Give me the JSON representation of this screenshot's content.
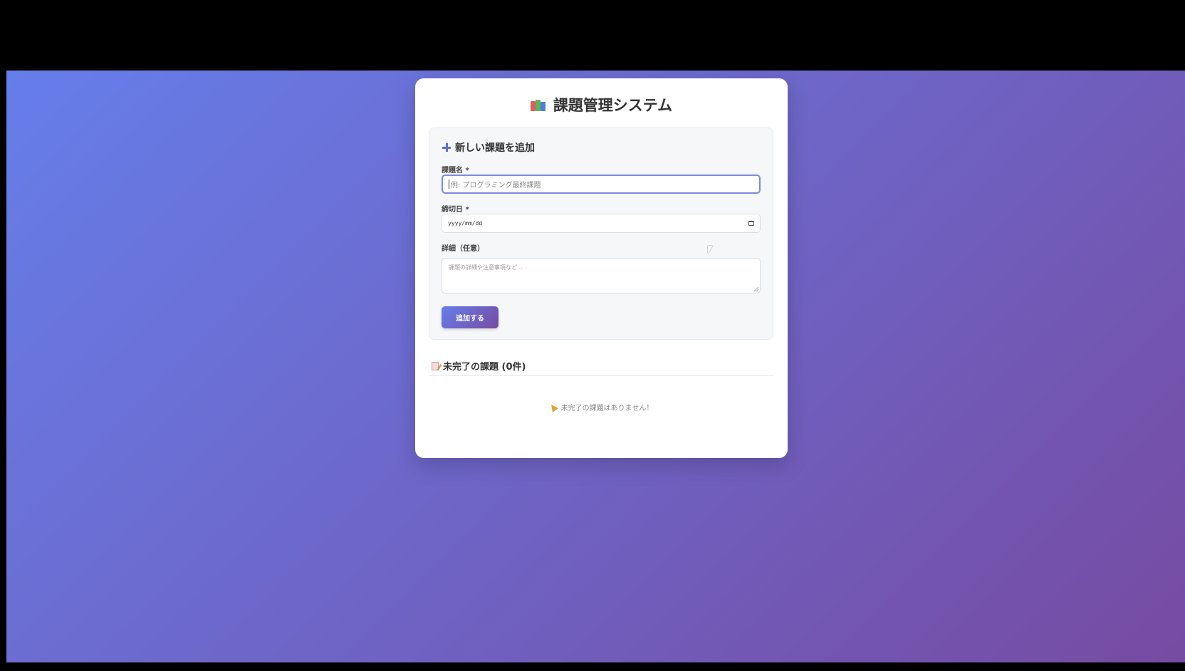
{
  "app": {
    "title": "課題管理システム",
    "title_icon": "books-icon"
  },
  "form": {
    "heading": "新しい課題を追加",
    "heading_icon": "plus-icon",
    "name_label": "課題名 *",
    "name_placeholder": "例: プログラミング最終課題",
    "due_label": "締切日 *",
    "due_placeholder": "yyyy/mm/dd",
    "detail_label": "詳細（任意）",
    "detail_placeholder": "課題の詳細や注意事項など...",
    "submit_label": "追加する"
  },
  "list": {
    "heading": "未完了の課題 (0件)",
    "heading_icon": "memo-icon",
    "empty_message": "未完了の課題はありません！",
    "empty_icon": "party-popper-icon"
  },
  "colors": {
    "gradient_start": "#667eea",
    "gradient_end": "#764ba2",
    "card_background": "#ffffff",
    "panel_background": "#f5f7f9"
  }
}
